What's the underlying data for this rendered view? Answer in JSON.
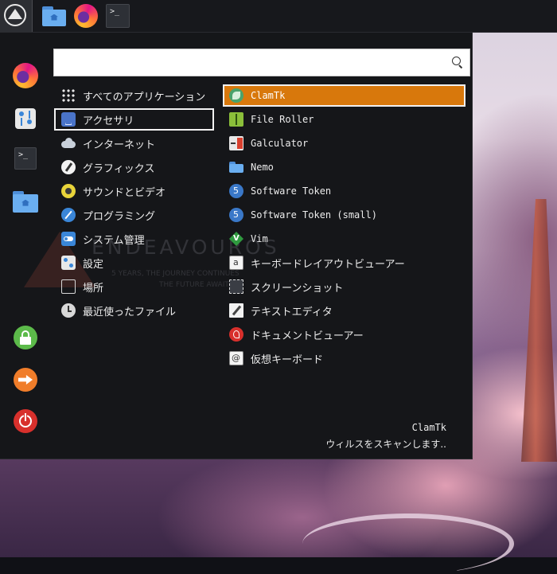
{
  "panel": {
    "menu_button_icon": "endeavouros-logo-icon",
    "launchers": [
      {
        "name": "file-manager",
        "icon": "home-folder-icon"
      },
      {
        "name": "web-browser",
        "icon": "firefox-icon"
      },
      {
        "name": "terminal",
        "icon": "terminal-icon",
        "glyph": ">_"
      }
    ]
  },
  "wallpaper": {
    "watermark_title": "ENDEAVOUROS",
    "watermark_line1": "5 YEARS, THE JOURNEY CONTINUES",
    "watermark_line2": "THE FUTURE AWAITS"
  },
  "menu": {
    "search": {
      "value": "",
      "placeholder": "",
      "icon": "search-icon"
    },
    "sidebar": [
      {
        "name": "firefox",
        "icon": "firefox-icon"
      },
      {
        "name": "settings",
        "icon": "settings-icon"
      },
      {
        "name": "terminal",
        "icon": "terminal-icon",
        "glyph": ">_"
      },
      {
        "name": "home-folder",
        "icon": "home-folder-icon"
      },
      {
        "name": "lock-screen",
        "icon": "lock-icon"
      },
      {
        "name": "logout",
        "icon": "logout-icon"
      },
      {
        "name": "shutdown",
        "icon": "power-icon"
      }
    ],
    "categories": [
      {
        "label": "すべてのアプリケーション",
        "icon": "grid-icon"
      },
      {
        "label": "アクセサリ",
        "icon": "accessories-icon",
        "selected": true
      },
      {
        "label": "インターネット",
        "icon": "cloud-icon"
      },
      {
        "label": "グラフィックス",
        "icon": "graphics-icon"
      },
      {
        "label": "サウンドとビデオ",
        "icon": "multimedia-icon"
      },
      {
        "label": "プログラミング",
        "icon": "programming-icon"
      },
      {
        "label": "システム管理",
        "icon": "system-toggle-icon"
      },
      {
        "label": "設定",
        "icon": "settings-icon"
      },
      {
        "label": "場所",
        "icon": "folder-outline-icon"
      },
      {
        "label": "最近使ったファイル",
        "icon": "clock-icon"
      }
    ],
    "apps": [
      {
        "label": "ClamTk",
        "icon": "clamtk-icon",
        "selected": true
      },
      {
        "label": "File Roller",
        "icon": "archive-icon"
      },
      {
        "label": "Galculator",
        "icon": "calculator-icon"
      },
      {
        "label": "Nemo",
        "icon": "folder-icon"
      },
      {
        "label": "Software Token",
        "icon": "software-token-icon"
      },
      {
        "label": "Software Token (small)",
        "icon": "software-token-icon"
      },
      {
        "label": "Vim",
        "icon": "vim-icon"
      },
      {
        "label": "キーボードレイアウトビューアー",
        "icon": "keyboard-layout-icon"
      },
      {
        "label": "スクリーンショット",
        "icon": "screenshot-icon"
      },
      {
        "label": "テキストエディタ",
        "icon": "text-editor-icon"
      },
      {
        "label": "ドキュメントビューアー",
        "icon": "document-viewer-icon"
      },
      {
        "label": "仮想キーボード",
        "icon": "virtual-keyboard-icon"
      }
    ],
    "footer": {
      "title": "ClamTk",
      "description": "ウィルスをスキャンします.."
    }
  }
}
